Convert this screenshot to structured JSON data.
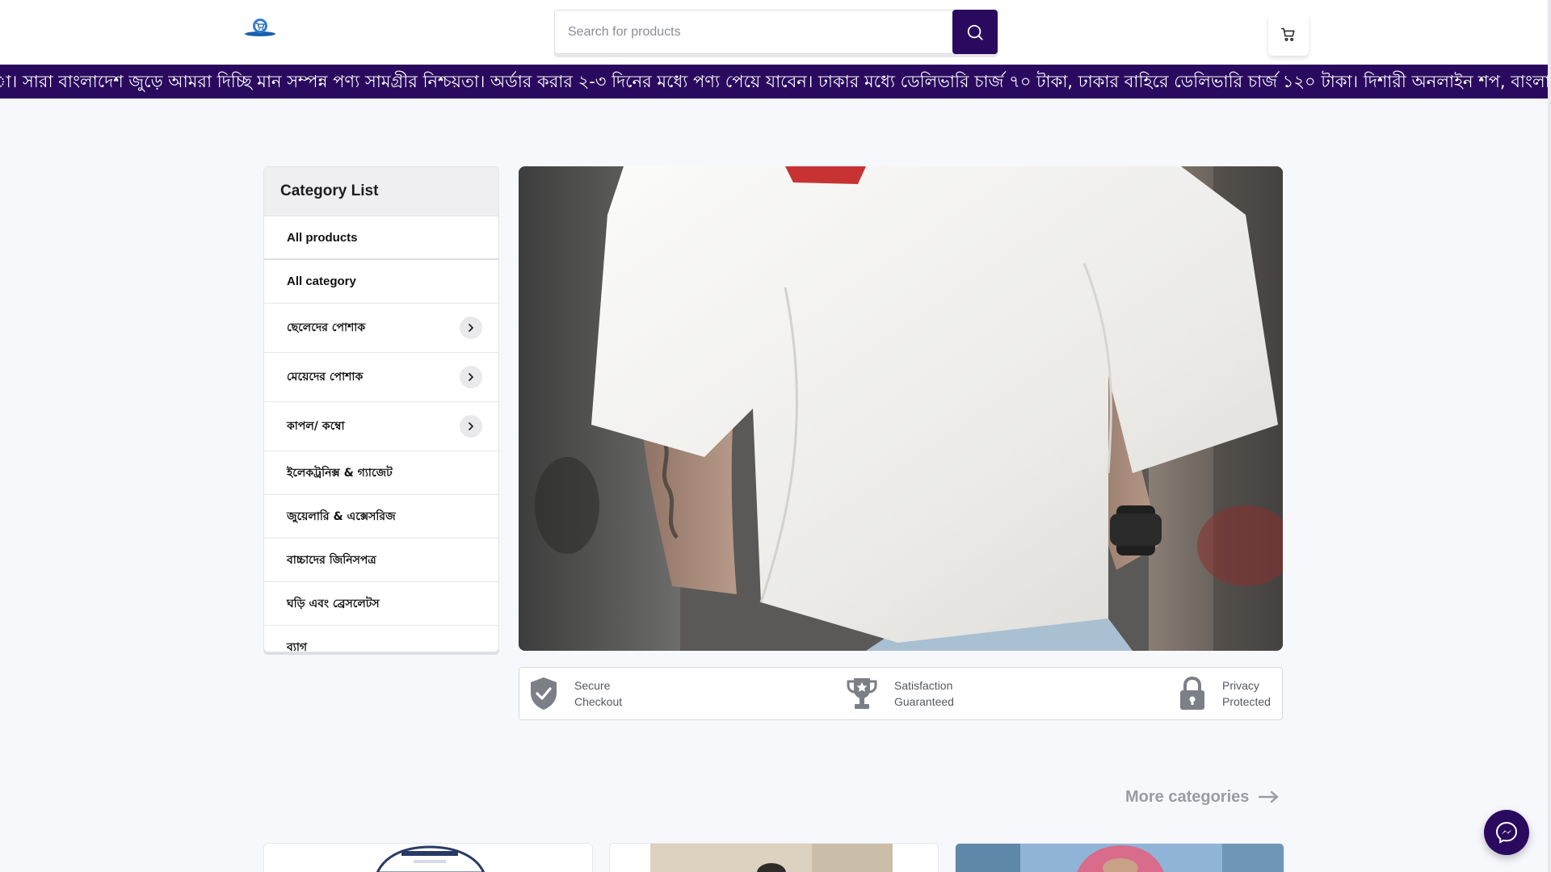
{
  "header": {
    "logo_icon": "shop-logo-icon",
    "search": {
      "placeholder": "Search for products",
      "value": ""
    },
    "search_button_icon": "search-icon",
    "cart_icon": "cart-icon"
  },
  "marquee": {
    "text": "া। সারা বাংলাদেশ জুড়ে আমরা দিচ্ছি মান সম্পন্ন পণ্য সামগ্রীর নিশ্চয়তা। অর্ডার করার ২-৩ দিনের মধ্যে পণ্য পেয়ে যাবেন। ঢাকার মধ্যে ডেলিভারি চার্জ ৭০ টাকা, ঢাকার বাহিরে ডেলিভারি চার্জ ১২০ টাকা।       দিশারী অনলাইন শপ, বাংলাদেশ এর"
  },
  "category_panel": {
    "title": "Category List",
    "items": [
      {
        "label": "All products"
      },
      {
        "label": "All category"
      },
      {
        "label": "ছেলেদের পোশাক"
      },
      {
        "label": "মেয়েদের পোশাক"
      },
      {
        "label": "কাপল/ কম্বো"
      },
      {
        "label": "ইলেকট্রনিক্স & গ্যাজেট"
      },
      {
        "label": "জুয়েলারি & এক্সেসরিজ"
      },
      {
        "label": "বাচ্চাদের জিনিসপত্র"
      },
      {
        "label": "ঘড়ি এবং ব্রেসলেটস"
      },
      {
        "label": "ব্যাগ"
      }
    ]
  },
  "hero": {
    "image": "man-white-tshirt-photo"
  },
  "trust_bar": [
    {
      "icon": "shield-check-icon",
      "line1": "Secure",
      "line2": "Checkout"
    },
    {
      "icon": "trophy-icon",
      "line1": "Satisfaction",
      "line2": "Guaranteed"
    },
    {
      "icon": "lock-icon",
      "line1": "Privacy",
      "line2": "Protected"
    }
  ],
  "more_categories": {
    "label": "More categories",
    "icon": "arrow-right-icon"
  },
  "messenger": {
    "icon": "messenger-icon"
  },
  "colors": {
    "brand": "#2a0a5e",
    "background": "#f7f8fb",
    "muted_text": "#9a9ca3"
  }
}
